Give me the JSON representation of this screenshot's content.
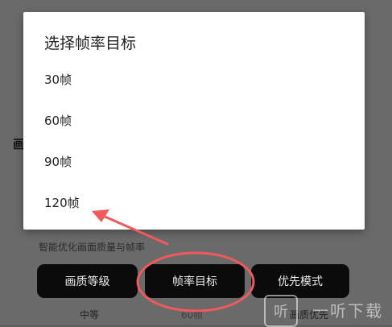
{
  "dialog": {
    "title": "选择帧率目标",
    "options": [
      "30帧",
      "60帧",
      "90帧",
      "120帧"
    ]
  },
  "background": {
    "left_label": "画",
    "hint": "智能优化画面质量与帧率",
    "buttons": {
      "quality": "画质等级",
      "framerate": "帧率目标",
      "priority": "优先模式"
    },
    "values": {
      "quality": "中等",
      "framerate": "60帧",
      "priority": "画质优先"
    }
  },
  "annotation": {
    "color": "#f05a5a"
  },
  "watermark": {
    "glyph": "听",
    "text": "一听下载"
  }
}
